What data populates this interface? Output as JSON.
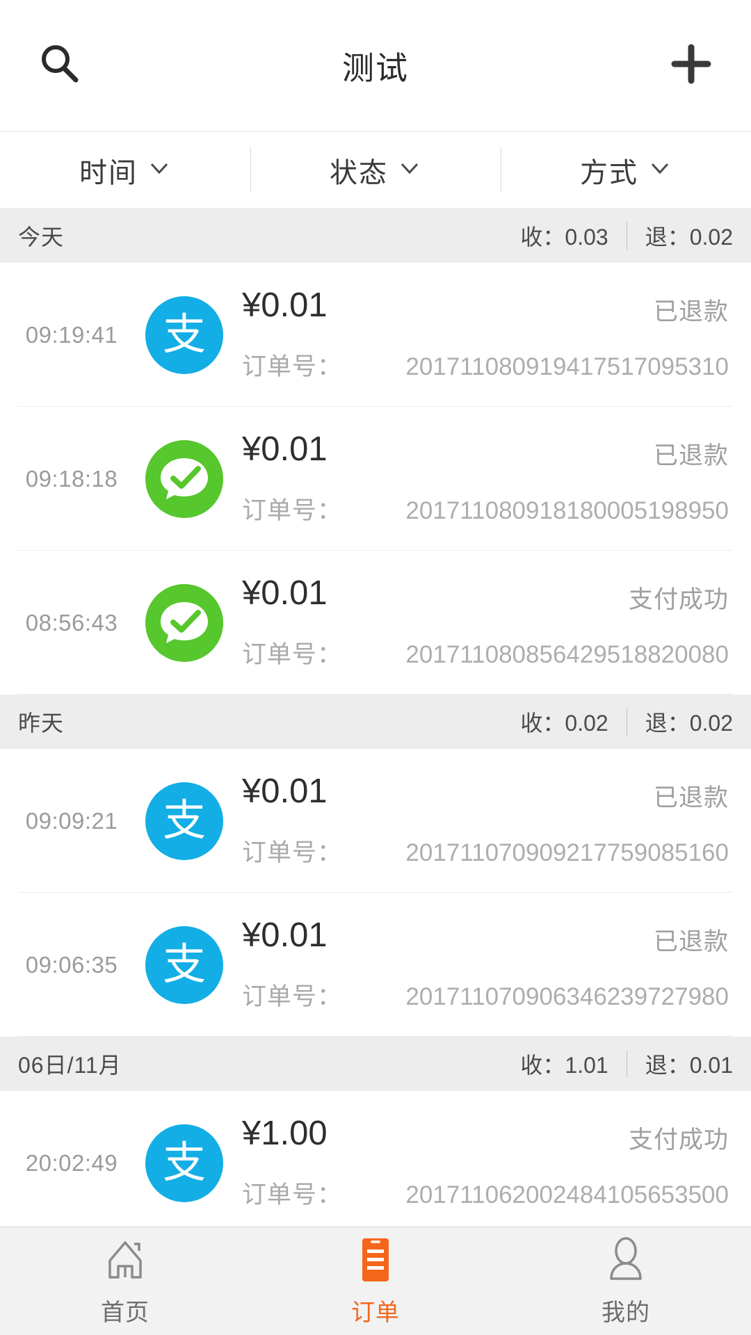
{
  "header": {
    "title": "测试",
    "search_icon": "search-icon",
    "add_icon": "plus-icon"
  },
  "filters": [
    {
      "label": "时间",
      "icon": "chevron-down-icon"
    },
    {
      "label": "状态",
      "icon": "chevron-down-icon"
    },
    {
      "label": "方式",
      "icon": "chevron-down-icon"
    }
  ],
  "order_label": "订单号：",
  "sections": [
    {
      "title": "今天",
      "income": "收：0.03",
      "refund": "退：0.02",
      "rows": [
        {
          "time": "09:19:41",
          "method": "alipay",
          "method_glyph": "支",
          "amount": "¥0.01",
          "status": "已退款",
          "order_no": "201711080919417517095310"
        },
        {
          "time": "09:18:18",
          "method": "wechat",
          "method_glyph": "wechat-pay-icon",
          "amount": "¥0.01",
          "status": "已退款",
          "order_no": "201711080918180005198950"
        },
        {
          "time": "08:56:43",
          "method": "wechat",
          "method_glyph": "wechat-pay-icon",
          "amount": "¥0.01",
          "status": "支付成功",
          "order_no": "201711080856429518820080"
        }
      ]
    },
    {
      "title": "昨天",
      "income": "收：0.02",
      "refund": "退：0.02",
      "rows": [
        {
          "time": "09:09:21",
          "method": "alipay",
          "method_glyph": "支",
          "amount": "¥0.01",
          "status": "已退款",
          "order_no": "201711070909217759085160"
        },
        {
          "time": "09:06:35",
          "method": "alipay",
          "method_glyph": "支",
          "amount": "¥0.01",
          "status": "已退款",
          "order_no": "201711070906346239727980"
        }
      ]
    },
    {
      "title": "06日/11月",
      "income": "收：1.01",
      "refund": "退：0.01",
      "rows": [
        {
          "time": "20:02:49",
          "method": "alipay",
          "method_glyph": "支",
          "amount": "¥1.00",
          "status": "支付成功",
          "order_no": "201711062002484105653500"
        }
      ]
    }
  ],
  "tabbar": {
    "active_color": "#F4661B",
    "items": [
      {
        "label": "首页",
        "icon": "home-icon",
        "active": false
      },
      {
        "label": "订单",
        "icon": "order-list-icon",
        "active": true
      },
      {
        "label": "我的",
        "icon": "user-icon",
        "active": false
      }
    ]
  }
}
